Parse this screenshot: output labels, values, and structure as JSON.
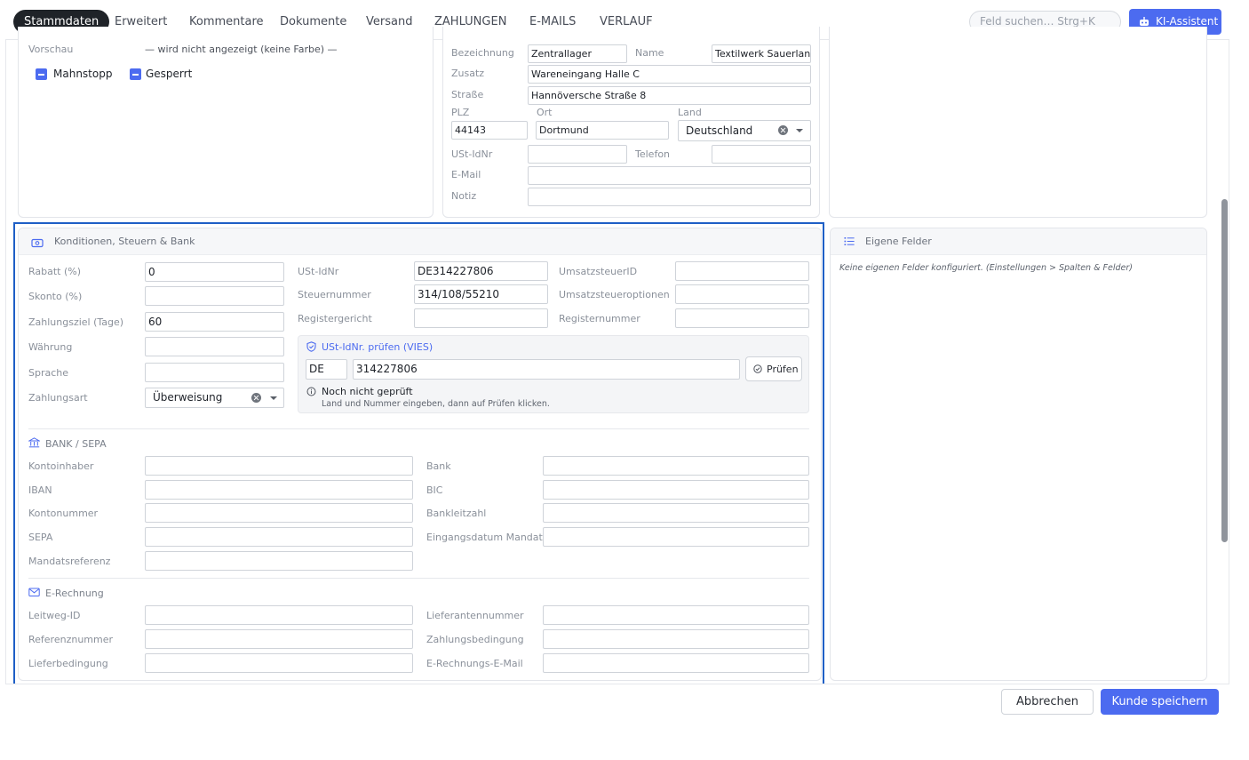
{
  "tabs": [
    {
      "label": "Stammdaten",
      "active": true
    },
    {
      "label": "Erweitert"
    },
    {
      "label": "Kommentare"
    },
    {
      "label": "Dokumente"
    },
    {
      "label": "Versand"
    },
    {
      "label": "ZAHLUNGEN"
    },
    {
      "label": "E-MAILS"
    },
    {
      "label": "VERLAUF"
    }
  ],
  "search": {
    "placeholder": "Feld suchen…  Strg+K"
  },
  "ki_button": {
    "label": "KI-Assistent"
  },
  "left_panel": {
    "preview_label": "Vorschau",
    "preview_value": "— wird nicht angezeigt (keine Farbe) —",
    "checkboxes": [
      {
        "label": "Mahnstopp",
        "state": "indeterminate"
      },
      {
        "label": "Gesperrt",
        "state": "indeterminate"
      }
    ]
  },
  "address": {
    "bezeichnung_label": "Bezeichnung",
    "bezeichnung": "Zentrallager",
    "name_label": "Name",
    "name": "Textilwerk Sauerland",
    "zusatz_label": "Zusatz",
    "zusatz": "Wareneingang Halle C",
    "strasse_label": "Straße",
    "strasse": "Hannöversche Straße 8",
    "plz_label": "PLZ",
    "plz": "44143",
    "ort_label": "Ort",
    "ort": "Dortmund",
    "land_label": "Land",
    "land": "Deutschland",
    "ustid_label": "USt-IdNr",
    "ustid": "",
    "telefon_label": "Telefon",
    "telefon": "",
    "email_label": "E-Mail",
    "email": "",
    "notiz_label": "Notiz",
    "notiz": ""
  },
  "konditionen": {
    "title": "Konditionen, Steuern & Bank",
    "rabatt_label": "Rabatt (%)",
    "rabatt": "0",
    "skonto_label": "Skonto (%)",
    "skonto": "",
    "zahlungsziel_label": "Zahlungsziel (Tage)",
    "zahlungsziel": "60",
    "waehrung_label": "Währung",
    "waehrung": "",
    "sprache_label": "Sprache",
    "sprache": "",
    "zahlungsart_label": "Zahlungsart",
    "zahlungsart": "Überweisung",
    "ustid_label": "USt-IdNr",
    "ustid": "DE314227806",
    "steuernummer_label": "Steuernummer",
    "steuernummer": "314/108/55210",
    "registergericht_label": "Registergericht",
    "registergericht": "",
    "umsatzsteuerid_label": "UmsatzsteuerID",
    "umsatzsteuerid": "",
    "umsatzsteueroptionen_label": "Umsatzsteueroptionen",
    "umsatzsteueroptionen": "",
    "registernummer_label": "Registernummer",
    "registernummer": "",
    "vies": {
      "title": "USt-IdNr. prüfen (VIES)",
      "country": "DE",
      "number": "314227806",
      "button": "Prüfen",
      "status": "Noch nicht geprüft",
      "hint": "Land und Nummer eingeben, dann auf Prüfen klicken."
    },
    "bank": {
      "title": "BANK / SEPA",
      "kontoinhaber_label": "Kontoinhaber",
      "kontoinhaber": "",
      "bank_label": "Bank",
      "bank": "",
      "iban_label": "IBAN",
      "iban": "",
      "bic_label": "BIC",
      "bic": "",
      "kontonummer_label": "Kontonummer",
      "kontonummer": "",
      "blz_label": "Bankleitzahl",
      "blz": "",
      "sepa_label": "SEPA",
      "sepa": "",
      "mandat_datum_label": "Eingangsdatum Mandat",
      "mandat_datum": "",
      "mandatsreferenz_label": "Mandatsreferenz",
      "mandatsreferenz": ""
    },
    "erechnung": {
      "title": "E-Rechnung",
      "leitweg_label": "Leitweg-ID",
      "leitweg": "",
      "lieferantennummer_label": "Lieferantennummer",
      "lieferantennummer": "",
      "referenznummer_label": "Referenznummer",
      "referenznummer": "",
      "zahlungsbedingung_label": "Zahlungsbedingung",
      "zahlungsbedingung": "",
      "lieferbedingung_label": "Lieferbedingung",
      "lieferbedingung": "",
      "email_label": "E-Rechnungs-E-Mail",
      "email": ""
    }
  },
  "eigene_felder": {
    "title": "Eigene Felder",
    "empty_text": "Keine eigenen Felder konfiguriert. (Einstellungen > Spalten & Felder)"
  },
  "footer": {
    "cancel": "Abbrechen",
    "save": "Kunde speichern"
  },
  "colors": {
    "accent": "#4c6bf0",
    "highlight": "#1e5fc6"
  }
}
